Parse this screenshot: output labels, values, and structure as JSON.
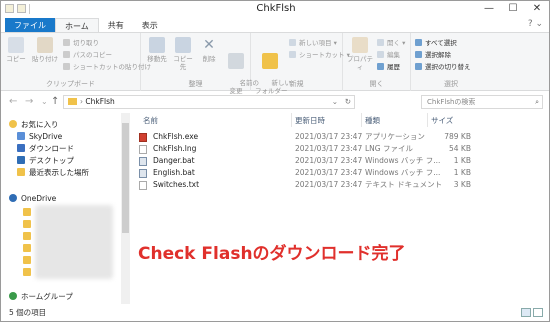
{
  "window": {
    "title": "ChkFlsh",
    "controls": [
      "—",
      "☐",
      "✕"
    ]
  },
  "ribbon_tabs": [
    "ファイル",
    "ホーム",
    "共有",
    "表示"
  ],
  "ribbon": {
    "clipboard": {
      "label": "クリップボード",
      "copy": "コピー",
      "paste": "貼り付け",
      "cut": "切り取り",
      "copy_path": "パスのコピー",
      "paste_shortcut": "ショートカットの貼り付け"
    },
    "organize": {
      "label": "整理",
      "move_to": "移動先",
      "copy_to": "コピー先",
      "delete": "削除",
      "rename": "名前の\n変更"
    },
    "new": {
      "label": "新規",
      "new_folder": "新しい\nフォルダー",
      "new_item": "新しい項目 ▾",
      "shortcut": "ショートカット ▾"
    },
    "open": {
      "label": "開く",
      "properties": "プロパティ",
      "open": "開く ▾",
      "edit": "編集",
      "history": "履歴"
    },
    "select": {
      "label": "選択",
      "select_all": "すべて選択",
      "select_none": "選択解除",
      "invert": "選択の切り替え"
    }
  },
  "address": {
    "path": "ChkFlsh",
    "search_placeholder": "ChkFlshの検索"
  },
  "nav": {
    "items": [
      {
        "label": "お気に入り",
        "icon": "star-icon"
      },
      {
        "label": "SkyDrive",
        "icon": "cloud-icon"
      },
      {
        "label": "ダウンロード",
        "icon": "download-folder-icon"
      },
      {
        "label": "デスクトップ",
        "icon": "desktop-icon"
      },
      {
        "label": "最近表示した場所",
        "icon": "recent-icon"
      },
      {
        "label": "OneDrive",
        "icon": "onedrive-icon"
      },
      {
        "label": "ホームグループ",
        "icon": "homegroup-icon"
      }
    ]
  },
  "columns": {
    "name": "名前",
    "date": "更新日時",
    "type": "種類",
    "size": "サイズ"
  },
  "files": [
    {
      "name": "ChkFlsh.exe",
      "date": "2021/03/17 23:47",
      "type": "アプリケーション",
      "size": "789 KB",
      "color": "#d04030"
    },
    {
      "name": "ChkFlsh.lng",
      "date": "2021/03/17 23:47",
      "type": "LNG ファイル",
      "size": "54 KB",
      "color": "#ffffff"
    },
    {
      "name": "Danger.bat",
      "date": "2021/03/17 23:47",
      "type": "Windows バッチ フ...",
      "size": "1 KB",
      "color": "#7a8fa8"
    },
    {
      "name": "English.bat",
      "date": "2021/03/17 23:47",
      "type": "Windows バッチ フ...",
      "size": "1 KB",
      "color": "#7a8fa8"
    },
    {
      "name": "Switches.txt",
      "date": "2021/03/17 23:47",
      "type": "テキスト ドキュメント",
      "size": "3 KB",
      "color": "#ffffff"
    }
  ],
  "caption": "Check Flashのダウンロード完了",
  "status": {
    "count": "5 個の項目"
  },
  "colors": {
    "accent": "#1979ca",
    "caption": "#e0302c",
    "folder": "#f0c24a"
  }
}
